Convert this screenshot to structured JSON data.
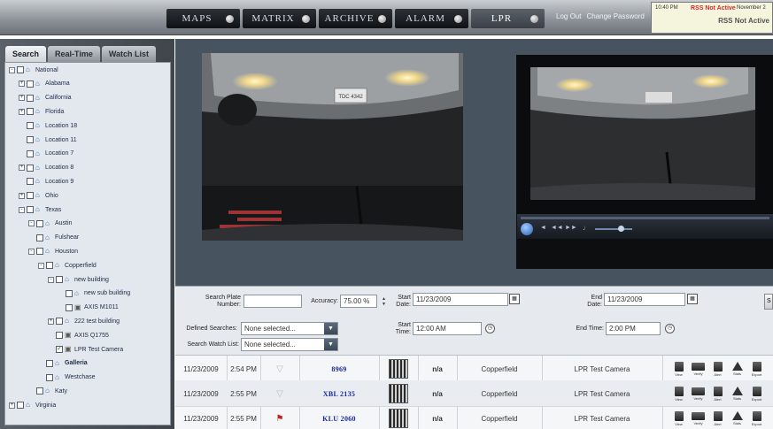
{
  "colors": {
    "topbar": "#8a9096",
    "tab_bg": "#14181c",
    "tree_bg": "#e3e8ee",
    "plate_text": "#17289e",
    "alert_red": "#d22a2a"
  },
  "topbar": {
    "tabs": [
      "MAPS",
      "MATRIX",
      "ARCHIVE",
      "ALARM",
      "LPR"
    ],
    "active_tab": "LPR",
    "logout": "Log Out",
    "change_password": "Change Password",
    "alert": {
      "time": "10:40 PM",
      "status": "RSS Not Active",
      "date": "November 2",
      "message": "RSS Not Active"
    }
  },
  "left": {
    "tabs": [
      "Search",
      "Real-Time",
      "Watch List"
    ],
    "active_tab": "Search",
    "tree": [
      {
        "label": "National",
        "checked": false,
        "icon": "site"
      },
      {
        "label": "Alabama",
        "checked": false,
        "icon": "site"
      },
      {
        "label": "California",
        "checked": false,
        "icon": "site"
      },
      {
        "label": "Florida",
        "checked": false,
        "icon": "site"
      },
      {
        "label": "Location 18",
        "checked": false,
        "icon": "site"
      },
      {
        "label": "Location 11",
        "checked": false,
        "icon": "site"
      },
      {
        "label": "Location 7",
        "checked": false,
        "icon": "site"
      },
      {
        "label": "Location 8",
        "checked": false,
        "icon": "site"
      },
      {
        "label": "Location 9",
        "checked": false,
        "icon": "site"
      },
      {
        "label": "Ohio",
        "checked": false,
        "icon": "site"
      },
      {
        "label": "Texas",
        "checked": false,
        "icon": "site"
      },
      {
        "label": "Austin",
        "checked": false,
        "icon": "site"
      },
      {
        "label": "Fulshear",
        "checked": false,
        "icon": "site"
      },
      {
        "label": "Houston",
        "checked": false,
        "icon": "site"
      },
      {
        "label": "Copperfield",
        "checked": false,
        "icon": "site"
      },
      {
        "label": "new building",
        "checked": false,
        "icon": "site"
      },
      {
        "label": "new sub building",
        "checked": false,
        "icon": "site"
      },
      {
        "label": "AXIS M1011",
        "checked": false,
        "icon": "camera"
      },
      {
        "label": "222 test building",
        "checked": false,
        "icon": "site"
      },
      {
        "label": "AXIS Q1755",
        "checked": false,
        "icon": "camera"
      },
      {
        "label": "LPR Test Camera",
        "checked": true,
        "icon": "camera"
      },
      {
        "label": "Galleria",
        "checked": false,
        "icon": "site"
      },
      {
        "label": "Westchase",
        "checked": false,
        "icon": "site"
      },
      {
        "label": "Katy",
        "checked": false,
        "icon": "site"
      },
      {
        "label": "Virginia",
        "checked": false,
        "icon": "site"
      }
    ]
  },
  "video": {
    "plate_text": "TDC 4342"
  },
  "search": {
    "plate_label": "Search Plate Number:",
    "plate_value": "",
    "accuracy_label": "Accuracy:",
    "accuracy_value": "75.00 %",
    "start_date_label": "Start Date:",
    "start_date_value": "11/23/2009",
    "end_date_label": "End Date:",
    "end_date_value": "11/23/2009",
    "start_time_label": "Start Time:",
    "start_time_value": "12:00 AM",
    "end_time_label": "End Time:",
    "end_time_value": "2:00 PM",
    "defined_searches_label": "Defined Searches:",
    "defined_searches_value": "None selected...",
    "watch_list_label": "Search Watch List:",
    "watch_list_value": "None selected..."
  },
  "results": {
    "action_labels": [
      "View",
      "Verify",
      "Alert",
      "Stats",
      "Export"
    ],
    "rows": [
      {
        "date": "11/23/2009",
        "time": "2:54 PM",
        "flagged": false,
        "plate": "8969",
        "state": "n/a",
        "site": "Copperfield",
        "camera": "LPR Test Camera"
      },
      {
        "date": "11/23/2009",
        "time": "2:55 PM",
        "flagged": false,
        "plate": "XBL 2135",
        "state": "n/a",
        "site": "Copperfield",
        "camera": "LPR Test Camera"
      },
      {
        "date": "11/23/2009",
        "time": "2:55 PM",
        "flagged": true,
        "plate": "KLU 2060",
        "state": "n/a",
        "site": "Copperfield",
        "camera": "LPR Test Camera"
      }
    ]
  }
}
